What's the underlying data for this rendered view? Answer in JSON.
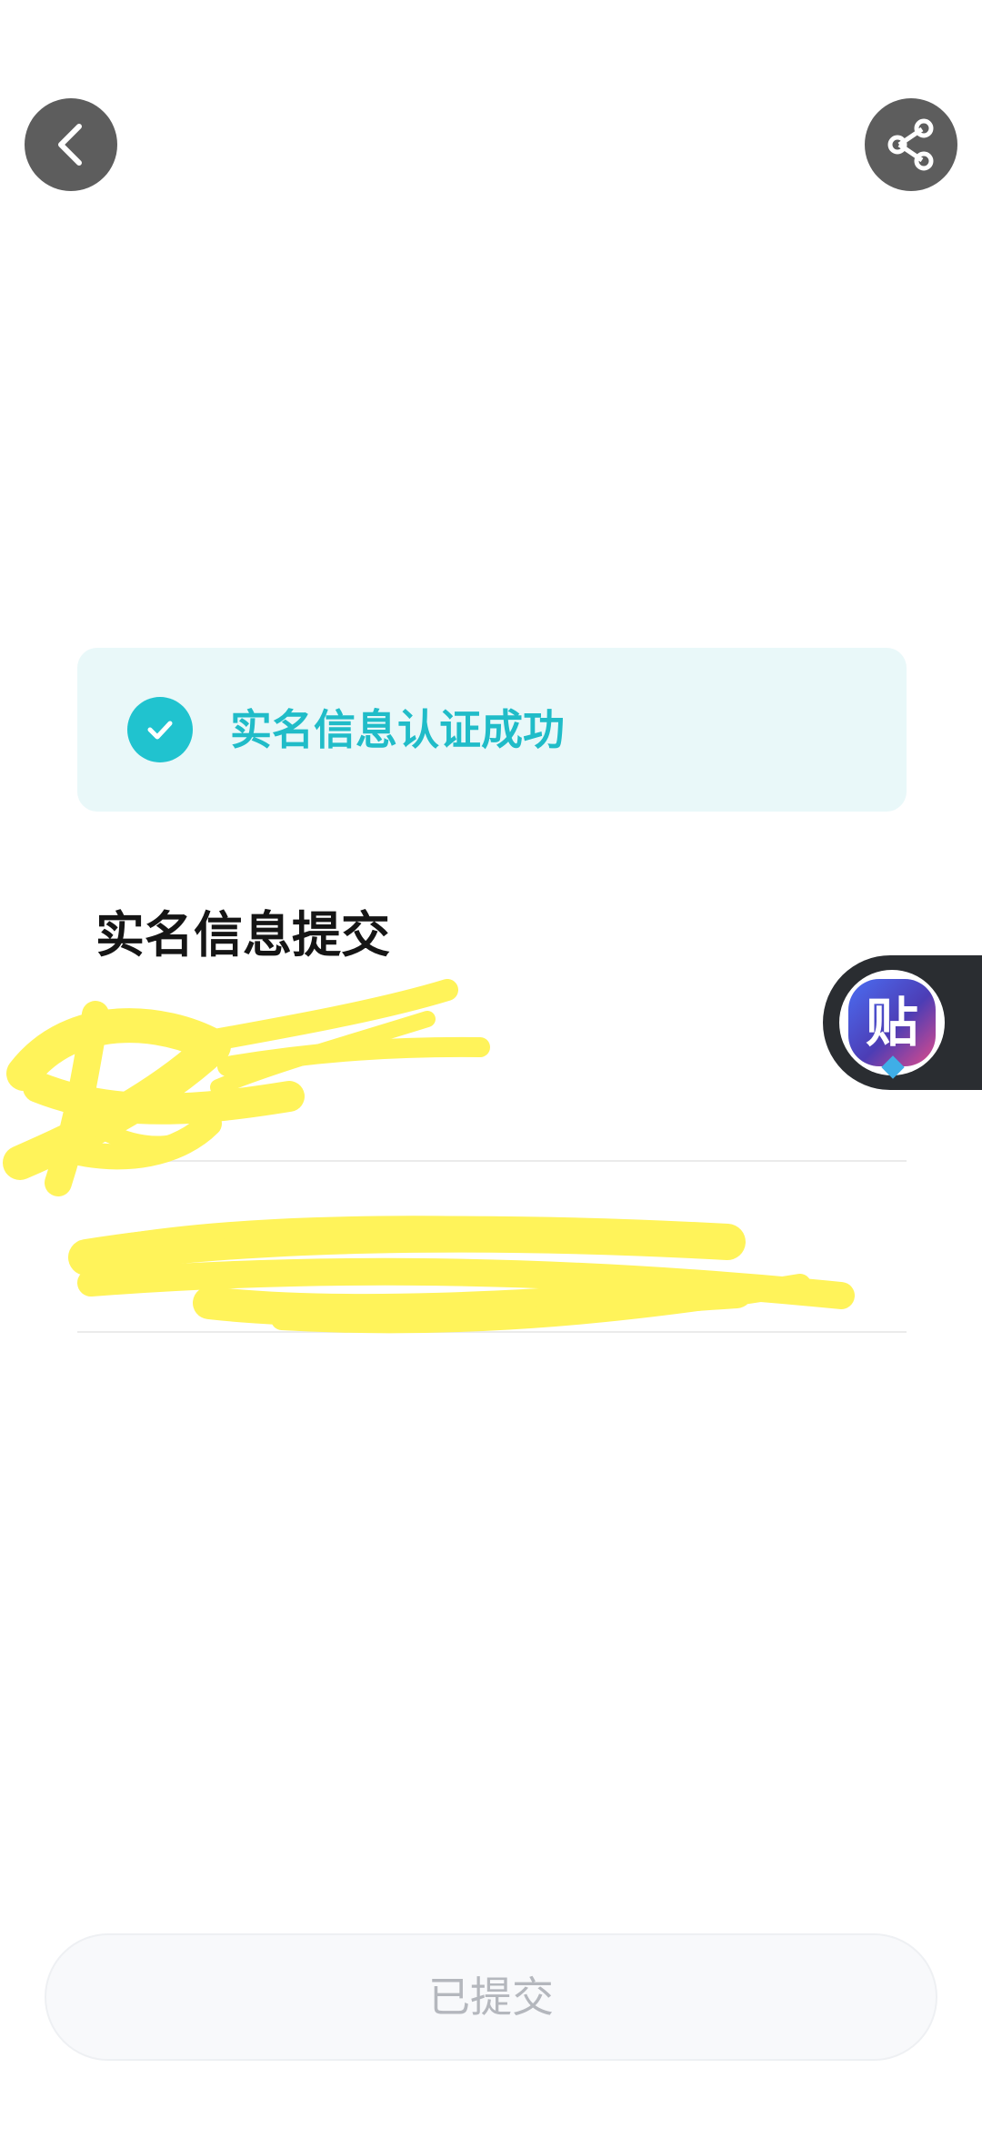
{
  "top_bar": {
    "back_icon": "chevron-left-icon",
    "share_icon": "share-icon"
  },
  "status_card": {
    "icon": "check-circle-icon",
    "text": "实名信息认证成功",
    "accent_color": "#20c3cf",
    "background_color": "#e9f8f9"
  },
  "form": {
    "title": "实名信息提交",
    "name_value": "",
    "id_value": ""
  },
  "floating_button": {
    "icon": "tieba-icon",
    "label": "贴"
  },
  "submit": {
    "label": "已提交"
  }
}
